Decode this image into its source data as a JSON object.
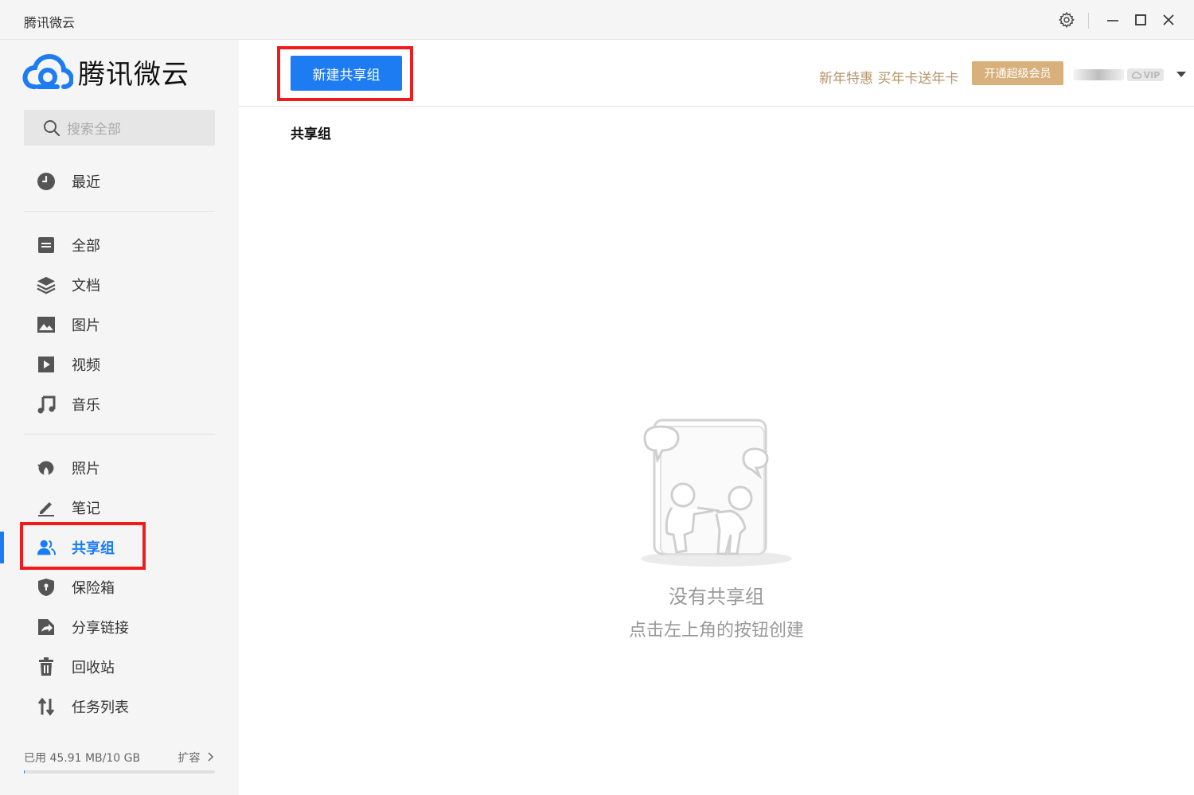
{
  "window": {
    "title": "腾讯微云"
  },
  "sidebar": {
    "logo_text": "腾讯微云",
    "search_placeholder": "搜索全部",
    "items": [
      {
        "label": "最近",
        "icon": "clock-icon"
      },
      {
        "label": "全部",
        "icon": "file-icon"
      },
      {
        "label": "文档",
        "icon": "layers-icon"
      },
      {
        "label": "图片",
        "icon": "image-icon"
      },
      {
        "label": "视频",
        "icon": "video-icon"
      },
      {
        "label": "音乐",
        "icon": "music-icon"
      },
      {
        "label": "照片",
        "icon": "photo-petal-icon"
      },
      {
        "label": "笔记",
        "icon": "pen-icon"
      },
      {
        "label": "共享组",
        "icon": "users-icon",
        "active": true
      },
      {
        "label": "保险箱",
        "icon": "shield-icon"
      },
      {
        "label": "分享链接",
        "icon": "share-link-icon"
      },
      {
        "label": "回收站",
        "icon": "trash-icon"
      },
      {
        "label": "任务列表",
        "icon": "transfer-icon"
      }
    ],
    "storage": {
      "text": "已用 45.91 MB/10 GB",
      "expand_label": "扩容",
      "used_fraction": 0.0045
    }
  },
  "toolbar": {
    "new_group_label": "新建共享组",
    "promo_text": "新年特惠 买年卡送年卡",
    "vip_button_label": "开通超级会员",
    "vip_badge": "VIP"
  },
  "main": {
    "section_title": "共享组",
    "empty_title": "没有共享组",
    "empty_subtitle": "点击左上角的按钮创建"
  },
  "colors": {
    "accent": "#1e7cf2",
    "promo": "#b5946a",
    "vip_button": "#d8b07c",
    "highlight": "#ee1c1c"
  }
}
